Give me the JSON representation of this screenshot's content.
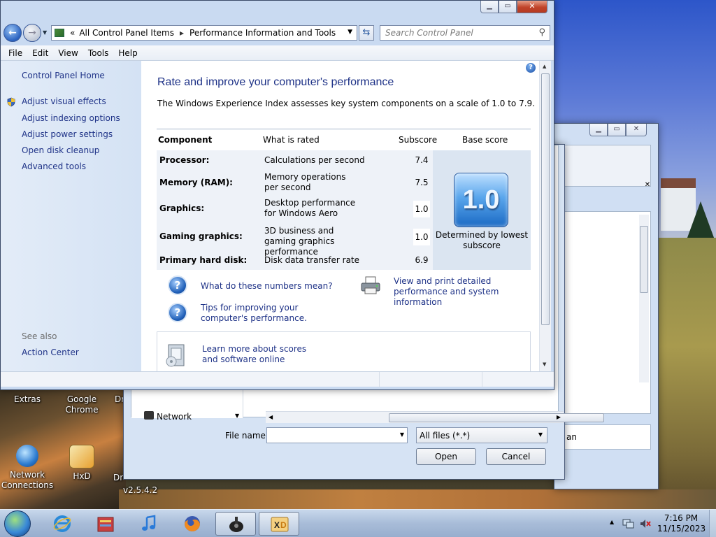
{
  "main_window": {
    "address": {
      "root": "All Control Panel Items",
      "current": "Performance Information and Tools",
      "chevron": "«"
    },
    "search_placeholder": "Search Control Panel",
    "menu": [
      "File",
      "Edit",
      "View",
      "Tools",
      "Help"
    ],
    "sidebar": {
      "home": "Control Panel Home",
      "links": [
        "Adjust visual effects",
        "Adjust indexing options",
        "Adjust power settings",
        "Open disk cleanup",
        "Advanced tools"
      ],
      "see_also": "See also",
      "see_also_links": [
        "Action Center"
      ]
    },
    "content": {
      "title": "Rate and improve your computer's performance",
      "description": "The Windows Experience Index assesses key system components on a scale of 1.0 to 7.9.",
      "table": {
        "headers": [
          "Component",
          "What is rated",
          "Subscore",
          "Base score"
        ],
        "rows": [
          {
            "component": "Processor:",
            "what": "Calculations per second",
            "subscore": "7.4"
          },
          {
            "component": "Memory (RAM):",
            "what": "Memory operations per second",
            "subscore": "7.5"
          },
          {
            "component": "Graphics:",
            "what": "Desktop performance for Windows Aero",
            "subscore": "1.0"
          },
          {
            "component": "Gaming graphics:",
            "what": "3D business and gaming graphics performance",
            "subscore": "1.0"
          },
          {
            "component": "Primary hard disk:",
            "what": "Disk data transfer rate",
            "subscore": "6.9"
          }
        ],
        "base_score": "1.0",
        "base_note": "Determined by lowest subscore"
      },
      "links": {
        "numbers": "What do these numbers mean?",
        "tips": "Tips for improving your computer's performance.",
        "print": "View and print detailed performance and system information",
        "learn": "Learn more about scores and software online"
      }
    }
  },
  "file_dialog": {
    "nav_item": "Network",
    "file_name_label": "File name:",
    "file_type": "All files (*.*)",
    "open_label": "Open",
    "cancel_label": "Cancel",
    "partial_text": "an"
  },
  "desktop": {
    "icons": [
      {
        "label": "Extras"
      },
      {
        "label": "Google Chrome"
      },
      {
        "label": "Dr"
      },
      {
        "label": "Network Connections"
      },
      {
        "label": "HxD"
      },
      {
        "label": "Dr"
      }
    ],
    "version_text": "v2.5.4.2"
  },
  "taskbar": {
    "time": "7:16 PM",
    "date": "11/15/2023",
    "tray_arrow": "▲"
  },
  "colors": {
    "link": "#1e3287",
    "window_frame": "#c9daf1",
    "table_bg": "#eef2f8"
  }
}
